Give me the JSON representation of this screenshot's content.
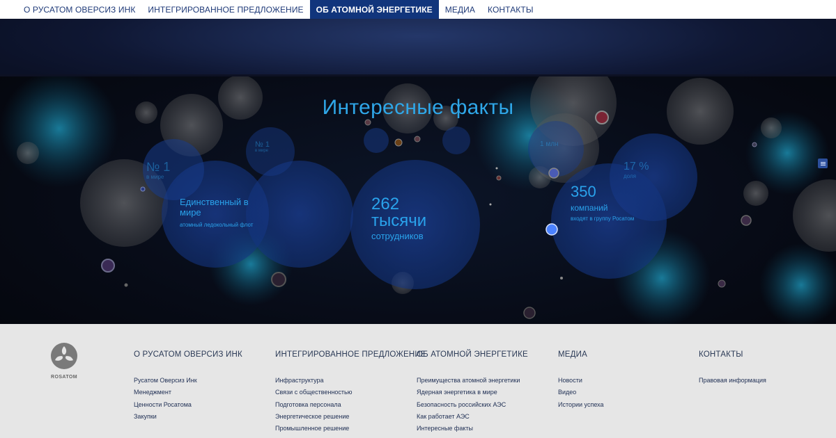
{
  "nav": {
    "items": [
      {
        "label": "О РУСАТОМ ОВЕРСИЗ ИНК"
      },
      {
        "label": "ИНТЕГРИРОВАННОЕ ПРЕДЛОЖЕНИЕ"
      },
      {
        "label": "ОБ АТОМНОЙ ЭНЕРГЕТИКЕ"
      },
      {
        "label": "МЕДИА"
      },
      {
        "label": "КОНТАКТЫ"
      }
    ],
    "active_index": 2
  },
  "facts": {
    "title": "Интересные факты",
    "items": [
      {
        "big": "№ 1",
        "sub": "в мире"
      },
      {
        "mid": "Единственный в мире",
        "small": "атомный ледокольный флот"
      },
      {
        "big": "262 тысячи",
        "mid": "сотрудников"
      },
      {
        "big": "350",
        "mid": "компаний",
        "small": "входят в группу Росатом"
      },
      {
        "big": "17 %",
        "sub": "доля"
      },
      {
        "small": "№ 1",
        "sub": "в мире"
      },
      {
        "small": "1 млн"
      }
    ],
    "accent_color": "#2aa3ec"
  },
  "footer": {
    "logo_text": "ROSATOM",
    "columns": [
      {
        "heading": "О РУСАТОМ ОВЕРСИЗ ИНК",
        "links": [
          "Русатом Оверсиз Инк",
          "Менеджмент",
          "Ценности Росатома",
          "Закупки"
        ]
      },
      {
        "heading": "ИНТЕГРИРОВАННОЕ ПРЕДЛОЖЕНИЕ",
        "links": [
          "Инфраструктура",
          "Связи с общественностью",
          "Подготовка персонала",
          "Энергетическое решение",
          "Промышленное решение"
        ]
      },
      {
        "heading": "ОБ АТОМНОЙ ЭНЕРГЕТИКЕ",
        "links": [
          "Преимущества атомной энергетики",
          "Ядерная энергетика в мире",
          "Безопасность российских АЭС",
          "Как работает АЭС",
          "Интересные факты"
        ]
      },
      {
        "heading": "МЕДИА",
        "links": [
          "Новости",
          "Видео",
          "Истории успеха"
        ]
      },
      {
        "heading": "КОНТАКТЫ",
        "links": [
          "Правовая информация"
        ]
      }
    ]
  }
}
